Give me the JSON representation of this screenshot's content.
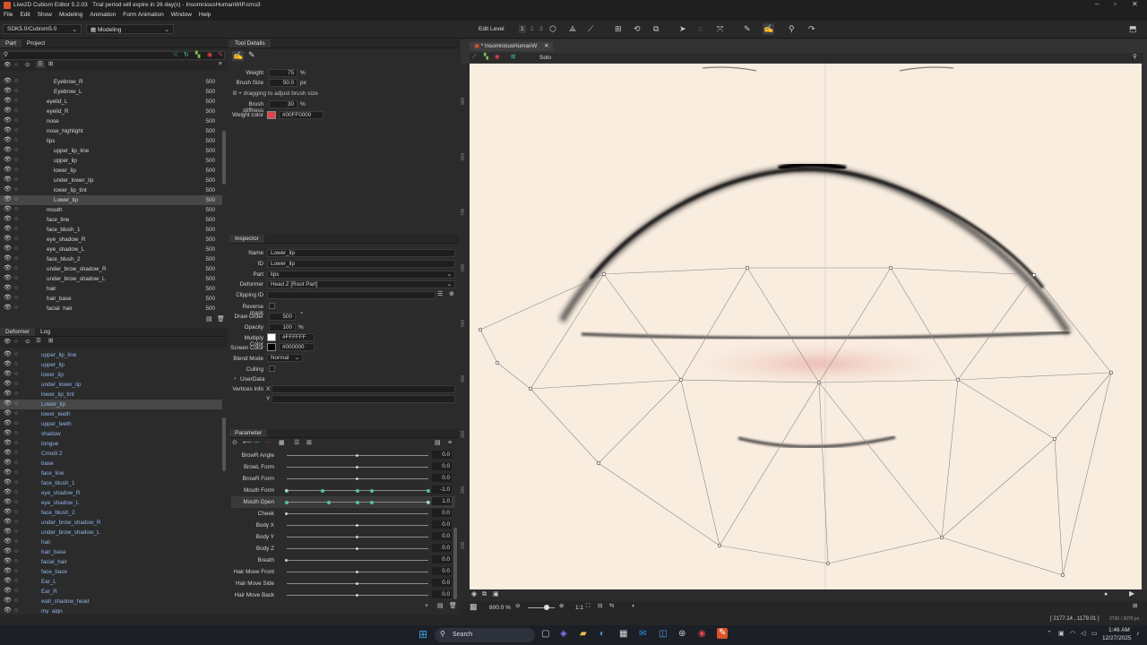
{
  "title": {
    "app": "Live2D Cubism Editor 5.2.03",
    "trial": "Trial period will expire in 26 day(s)",
    "file": "InsomniousHumanWIP.cmo3"
  },
  "menu": [
    "File",
    "Edit",
    "Show",
    "Modeling",
    "Animation",
    "Form Animation",
    "Window",
    "Help"
  ],
  "toolbar": {
    "sdk": "SDK5.0/Cubism5.0",
    "mode": "Modeling",
    "edit_level_label": "Edit Level",
    "edit_levels": [
      "1",
      "2",
      "3"
    ]
  },
  "part_panel": {
    "tabs": [
      "Part",
      "Project"
    ],
    "rows": [
      {
        "name": "Eyebrow_R",
        "value": "500"
      },
      {
        "name": "Eyebrow_L",
        "value": "500"
      },
      {
        "name": "eyelid_L",
        "value": "500"
      },
      {
        "name": "eyelid_R",
        "value": "500"
      },
      {
        "name": "nose",
        "value": "500"
      },
      {
        "name": "nose_highlight",
        "value": "500"
      },
      {
        "name": "lips",
        "value": "500"
      },
      {
        "name": "upper_lip_line",
        "value": "500"
      },
      {
        "name": "upper_lip",
        "value": "500"
      },
      {
        "name": "lower_lip",
        "value": "500"
      },
      {
        "name": "under_lower_lip",
        "value": "500"
      },
      {
        "name": "lower_lip_tint",
        "value": "500"
      },
      {
        "name": "Lower_lip",
        "value": "500"
      },
      {
        "name": "mouth",
        "value": "500"
      },
      {
        "name": "face_line",
        "value": "500"
      },
      {
        "name": "face_blush_1",
        "value": "500"
      },
      {
        "name": "eye_shadow_R",
        "value": "500"
      },
      {
        "name": "eye_shadow_L",
        "value": "500"
      },
      {
        "name": "face_blush_2",
        "value": "500"
      },
      {
        "name": "under_brow_shadow_R",
        "value": "500"
      },
      {
        "name": "under_brow_shadow_L",
        "value": "500"
      },
      {
        "name": "hair",
        "value": "500"
      },
      {
        "name": "hair_base",
        "value": "500"
      },
      {
        "name": "facial_hair",
        "value": "500"
      }
    ]
  },
  "deformer_panel": {
    "tabs": [
      "Deformer",
      "Log"
    ],
    "rows": [
      "upper_lip_line",
      "upper_lip",
      "lower_lip",
      "under_lower_lip",
      "lower_lip_tint",
      "Lower_lip",
      "lower_teeth",
      "upper_teeth",
      "shadow",
      "tongue",
      "Cmodi 2",
      "base",
      "face_line",
      "face_blush_1",
      "eye_shadow_R",
      "eye_shadow_L",
      "face_blush_2",
      "under_brow_shadow_R",
      "under_brow_shadow_L",
      "hair",
      "hair_base",
      "facial_hair",
      "face_base",
      "Ear_L",
      "Ear_R",
      "wall_shadow_head",
      "my_aign"
    ]
  },
  "tool_details": {
    "header": "Tool Details",
    "weight_label": "Weight",
    "weight": "75",
    "weight_unit": "%",
    "brush_size_label": "Brush Size",
    "brush_size": "50.0",
    "brush_size_unit": "px",
    "hint": "B + dragging to adjust brush size",
    "stiffness_label": "Brush stiffness",
    "stiffness": "30",
    "stiffness_unit": "%",
    "weight_color_label": "Weight color",
    "weight_color": "#00FF0000",
    "weight_color_swatch": "#e0444c"
  },
  "inspector": {
    "header": "Inspector",
    "name_label": "Name",
    "name": "Lower_lip",
    "id_label": "ID",
    "id": "Lower_lip",
    "part_label": "Part",
    "part": "lips",
    "deformer_label": "Deformer",
    "deformer": "Head Z  [Root Part]",
    "clipping_label": "Clipping ID",
    "clipping": "",
    "reverse_mask_label": "Reverse mask",
    "draw_order_label": "Draw Order",
    "draw_order": "500",
    "opacity_label": "Opacity",
    "opacity": "100",
    "opacity_unit": "%",
    "multiply_label": "Multiply Color",
    "multiply": "#FFFFFF",
    "screen_label": "Screen Color",
    "screen": "#000000",
    "blend_label": "Blend Mode",
    "blend": "Normal",
    "culling_label": "Culling",
    "userdata_label": "UserData",
    "vertices_label": "Vertices Info",
    "vx_label": "X",
    "vy_label": "Y"
  },
  "parameters": {
    "header": "Parameter",
    "rows": [
      {
        "name": "BrowR Angle",
        "value": "0.0",
        "fraction": 0.5,
        "keys": []
      },
      {
        "name": "BrowL Form",
        "value": "0.0",
        "fraction": 0.5,
        "keys": []
      },
      {
        "name": "BrowR Form",
        "value": "0.0",
        "fraction": 0.5,
        "keys": []
      },
      {
        "name": "Mouth Form",
        "value": "-1.0",
        "fraction": 0.0,
        "keys": [
          0.0,
          0.25,
          0.5,
          0.6,
          1.0
        ]
      },
      {
        "name": "Mouth Open",
        "value": "1.0",
        "fraction": 1.0,
        "keys": [
          0.0,
          0.3,
          0.5,
          0.6,
          1.0
        ]
      },
      {
        "name": "Cheek",
        "value": "0.0",
        "fraction": 0.0,
        "keys": []
      },
      {
        "name": "Body X",
        "value": "0.0",
        "fraction": 0.5,
        "keys": []
      },
      {
        "name": "Body Y",
        "value": "0.0",
        "fraction": 0.5,
        "keys": []
      },
      {
        "name": "Body Z",
        "value": "0.0",
        "fraction": 0.5,
        "keys": []
      },
      {
        "name": "Breath",
        "value": "0.0",
        "fraction": 0.0,
        "keys": []
      },
      {
        "name": "Hair Move Front",
        "value": "0.0",
        "fraction": 0.5,
        "keys": []
      },
      {
        "name": "Hair Move Side",
        "value": "0.0",
        "fraction": 0.5,
        "keys": []
      },
      {
        "name": "Hair Move Back",
        "value": "0.0",
        "fraction": 0.5,
        "keys": []
      }
    ]
  },
  "viewport": {
    "tab": "InsomniousHumanW",
    "solo": "Solo",
    "zoom": "800.0 %",
    "ratio": "1:1",
    "ruler": [
      "900",
      "800",
      "700",
      "600",
      "500",
      "400",
      "300",
      "200",
      "100"
    ],
    "coords": "[ 2177.14 , 1179.01 ]",
    "canvas_size": "2730 / 3070 px"
  },
  "taskbar": {
    "search": "Search",
    "time": "1:46 AM",
    "date": "12/27/2025"
  }
}
